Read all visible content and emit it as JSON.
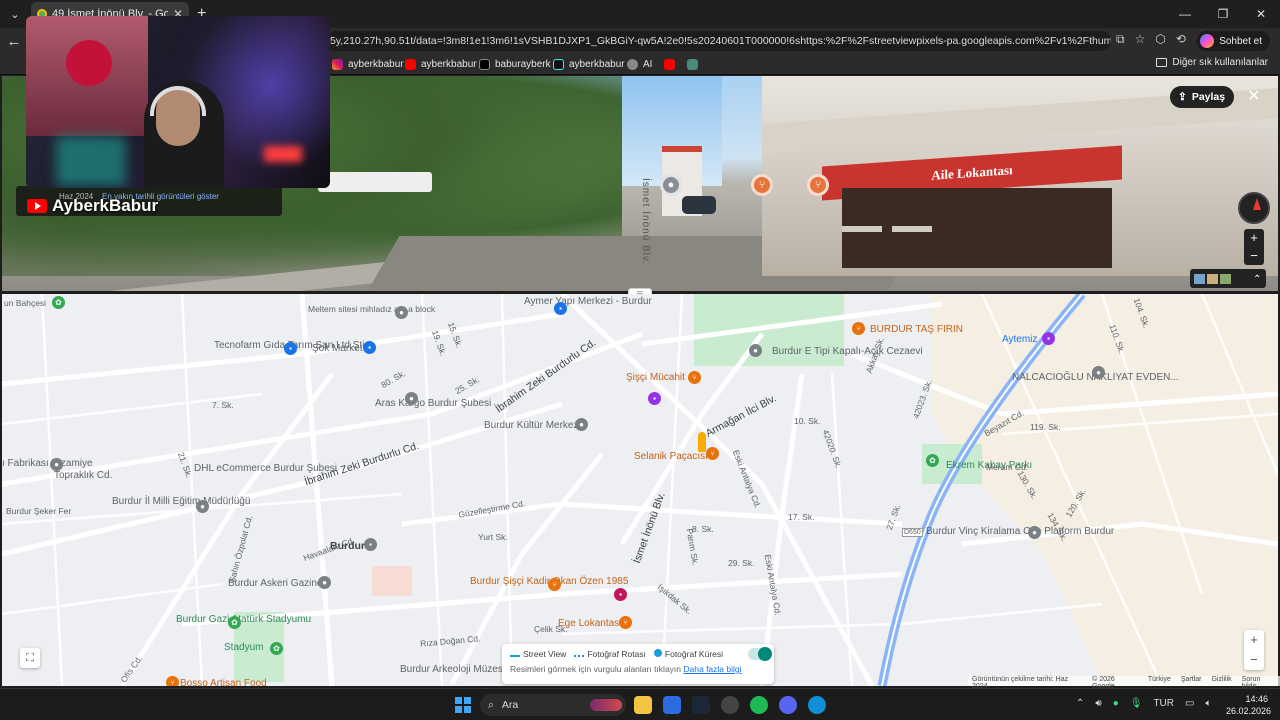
{
  "browser": {
    "tab_title": "49 İsmet İnönü Blv. - Google Harit...",
    "url": "5y,210.27h,90.51t/data=!3m8!1e1!3m6!1sVSHB1DJXP1_GkBGiY-qw5A!2e0!5s20240601T000000!6shttps:%2F%2Fstreetviewpixels-pa.googleapis.com%2Fv1%2Fthumbnail%3Fcb_cli...",
    "sohbet_label": "Sohbet et",
    "bookmarks": [
      "ayberkbabur",
      "ayberkbabur",
      "baburayberk",
      "ayberkbabur",
      "AI"
    ],
    "other_bookmarks": "Diğer sık kullanılanlar"
  },
  "streetview": {
    "share_label": "Paylaş",
    "sign_text": "Aile Lokantası",
    "date_label": "Haz 2024",
    "show_dates_link": "En yakın tarihli görüntüleri göster",
    "road_text": "İsmet İnönü Blv."
  },
  "webcam": {
    "channel_name": "AyberkBabur"
  },
  "map": {
    "labels": {
      "ayder": "Aymer Yapı Merkezi - Burdur",
      "meltem": "Meltem sitesi mihladız apt a block",
      "tecnofarm": "Tecnofarm Gıda Tarım San.Ltd.Şti",
      "sok": "Şok Market",
      "aras": "Aras Kargo Burdur Şubesi",
      "izeki1": "İbrahim Zeki Burdurlu Cd.",
      "izeki2": "İbrahim Zeki Burdurlu Cd.",
      "kultur": "Burdur Kültür Merkezi",
      "sisci": "Şişçi Mücahit",
      "selanik": "Selanik Paçacısı",
      "armagan": "Armağan İlci Blv.",
      "cezaevi": "Burdur E Tipi Kapalı-Açık Cezaevi",
      "tasfirin": "BURDUR TAŞ FIRIN",
      "aytemiz": "Aytemiz",
      "nalcaci": "NALCACIOĞLU NAKLIYAT EVDEN...",
      "dhl": "DHL eCommerce Burdur Şubesi",
      "milli": "Burdur İl Milli Eğitim Müdürlüğü",
      "toprakli": "Topraklık Cd.",
      "fabrikasi": "ı Fabrikası Nizamiye",
      "seker": "Burdur Şeker Fer",
      "burdur": "Burdur",
      "askeri": "Burdur Askeri Gazino",
      "gazi": "Burdur Gazi Atatürk Stadyumu",
      "stadyum": "Stadyum",
      "sisciKadir": "Burdur Şişçi Kadir Okan Özen 1985",
      "ege": "Ege Lokantası",
      "arkeoloji": "Burdur Arkeoloji Müzesi",
      "bosso": "Bosso Artisan Food",
      "ekrem": "Ekrem Kabay Parkı",
      "vinc": "Burdur Vinç Kiralama Can Platform Burdur",
      "ismet": "İsmet İnönü Blv.",
      "eskiAntalya1": "Eski Antalya Cd.",
      "eskiAntalya2": "Eski Antalya Cd.",
      "havaalani": "Havaalanı Cd.",
      "sahin": "Şahin Özpolat Cd.",
      "ofis": "Ofis Cd.",
      "guzel": "Güzelleştirme Cd.",
      "yurt": "Yurt Sk.",
      "meram": "Meram Cd.",
      "beyazit": "Beyazıt Cd.",
      "rizaDogan": "Rıza Doğan Cd.",
      "celik": "Çelik Sk.",
      "isikdak": "Işıkdak Sk.",
      "parim": "Parım Sk.",
      "bahcesi": "un Bahçesi",
      "d650": "D650",
      "akkay": "Akkay Sk."
    },
    "street_numbers": [
      "15. Sk.",
      "19. Sk.",
      "80. Sk.",
      "25. Sk.",
      "7. Sk.",
      "21. Sk.",
      "10. Sk.",
      "17. Sk.",
      "8. Sk.",
      "29. Sk.",
      "119. Sk.",
      "104. Sk.",
      "110. Sk.",
      "130. Sk.",
      "134. Sk.",
      "120. Sk.",
      "42023. Sk.",
      "42020. Sk.",
      "27. Sk."
    ],
    "legend": {
      "street_view": "Street View",
      "photo_route": "Fotoğraf Rotası",
      "photo_sphere": "Fotoğraf Küresi",
      "hint": "Resimleri görmek için vurgulu alanları tıklayın",
      "learn_more": "Daha fazla bilgi"
    },
    "attribution": [
      "Görüntünün çekilme tarihi: Haz 2024",
      "© 2026 Google",
      "Türkiye",
      "Şartlar",
      "Gizlilik",
      "Sorun bildir"
    ]
  },
  "taskbar": {
    "search_label": "Ara",
    "lang": "TUR",
    "time": "14:46",
    "date": "26.02.2026"
  }
}
